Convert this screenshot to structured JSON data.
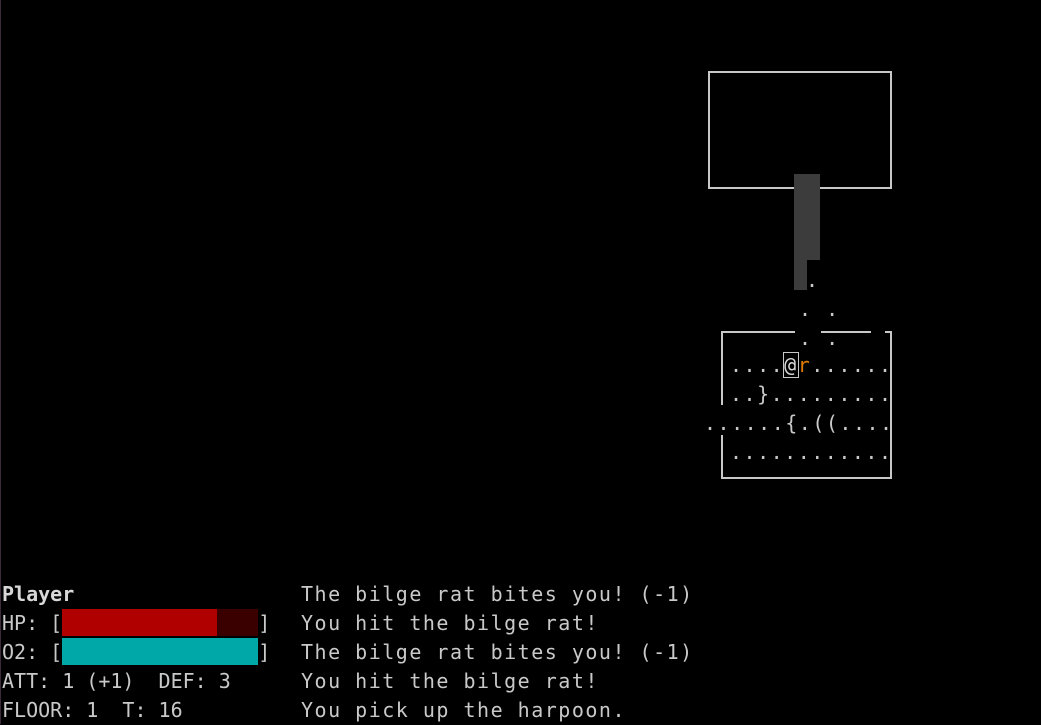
{
  "colors": {
    "hp_fill": "#b00000",
    "hp_empty": "#3a0000",
    "o2_fill": "#00a8a8",
    "o2_empty": "#003a3a",
    "rat": "#e07a00"
  },
  "map": {
    "corridor": [
      ".",
      ". .",
      ". ."
    ],
    "rows": [
      [
        "....",
        "@",
        "r",
        "......"
      ],
      [
        ". . } . . . . . . . . ."
      ],
      [
        ". . . . . . { . ( ( . . . ."
      ],
      [
        ". . . . . . . . . . . ."
      ]
    ],
    "player_glyph": "@",
    "rat_glyph": "r",
    "row1": "..}.........",
    "row2": "......{.((....",
    "row3": "............",
    "row0_left": "....",
    "row0_right": "......"
  },
  "hud": {
    "name": "Player",
    "hp_label": "HP: [",
    "o2_label": "O2: [",
    "bar_close": "]",
    "hp_fraction": 0.79,
    "o2_fraction": 1.0,
    "att_def": "ATT: 1 (+1)  DEF: 3",
    "floor_turn": "FLOOR: 1  T: 16"
  },
  "log": [
    "The bilge rat bites you! (-1)",
    "You hit the bilge rat!",
    "The bilge rat bites you! (-1)",
    "You hit the bilge rat!",
    "You pick up the harpoon."
  ]
}
